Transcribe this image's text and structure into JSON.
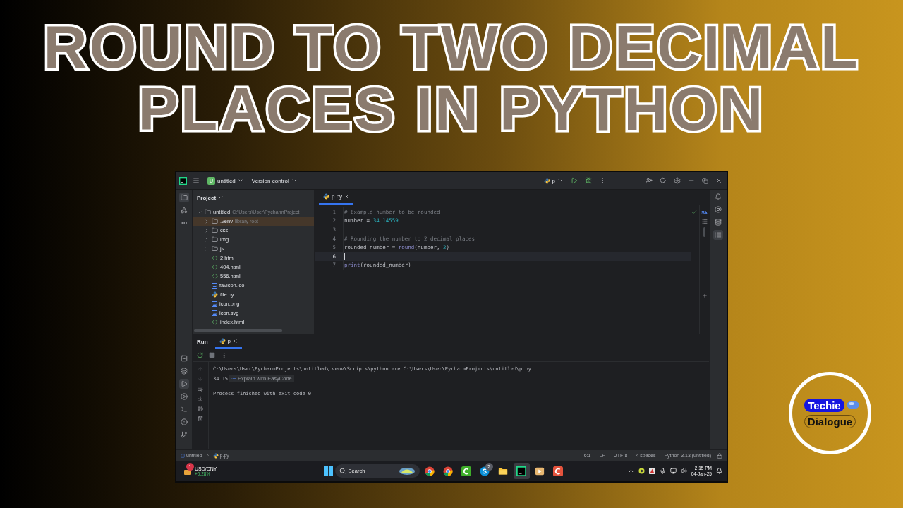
{
  "headline": [
    "ROUND TO TWO DECIMAL",
    "PLACES IN PYTHON"
  ],
  "ide": {
    "toolbar": {
      "project_badge": "U",
      "project": "untitled",
      "vcs": "Version control",
      "run_config": "p"
    },
    "project_panel": {
      "title": "Project",
      "tree": [
        {
          "name": "untitled",
          "path": "C:\\Users\\User\\PycharmProject",
          "kind": "folder",
          "expanded": true,
          "selected": false,
          "children": [
            {
              "name": ".venv",
              "note": "library root",
              "kind": "folder",
              "expanded": false,
              "selected": true
            },
            {
              "name": "css",
              "kind": "folder",
              "expanded": false,
              "selected": false
            },
            {
              "name": "img",
              "kind": "folder",
              "expanded": false,
              "selected": false
            },
            {
              "name": "js",
              "kind": "folder",
              "expanded": false,
              "selected": false
            },
            {
              "name": "2.html",
              "kind": "html",
              "selected": false
            },
            {
              "name": "404.html",
              "kind": "html",
              "selected": false
            },
            {
              "name": "556.html",
              "kind": "html",
              "selected": false
            },
            {
              "name": "favicon.ico",
              "kind": "image",
              "selected": false
            },
            {
              "name": "file.py",
              "kind": "python",
              "selected": false
            },
            {
              "name": "icon.png",
              "kind": "image",
              "selected": false
            },
            {
              "name": "icon.svg",
              "kind": "image",
              "selected": false
            },
            {
              "name": "index.html",
              "kind": "html",
              "selected": false
            }
          ]
        }
      ]
    },
    "editor": {
      "tabs": [
        {
          "label": "p.py",
          "selected": true
        }
      ],
      "side_label": "Sk",
      "lines": [
        {
          "number": "1",
          "current": false,
          "tokens": [
            {
              "text": "# Example number to be rounded",
              "kind": "comment"
            }
          ]
        },
        {
          "number": "2",
          "current": false,
          "tokens": [
            {
              "text": "number = ",
              "kind": "plain"
            },
            {
              "text": "34.14559",
              "kind": "number"
            }
          ]
        },
        {
          "number": "3",
          "current": false
        },
        {
          "number": "4",
          "current": false,
          "tokens": [
            {
              "text": "# Rounding the number to 2 decimal places",
              "kind": "comment"
            }
          ]
        },
        {
          "number": "5",
          "current": false,
          "tokens": [
            {
              "text": "rounded_number = ",
              "kind": "plain"
            },
            {
              "text": "round",
              "kind": "builtin"
            },
            {
              "text": "(number, ",
              "kind": "plain"
            },
            {
              "text": "2",
              "kind": "number"
            },
            {
              "text": ")",
              "kind": "plain"
            }
          ]
        },
        {
          "number": "6",
          "current": true
        },
        {
          "number": "7",
          "current": false,
          "tokens": [
            {
              "text": "print",
              "kind": "builtin"
            },
            {
              "text": "(rounded_number)",
              "kind": "plain"
            }
          ]
        }
      ]
    },
    "run_panel": {
      "title": "Run",
      "tabs": [
        {
          "label": "p",
          "selected": true
        }
      ],
      "command": "C:\\Users\\User\\PycharmProjects\\untitled\\.venv\\Scripts\\python.exe C:\\Users\\User\\PycharmProjects\\untitled\\p.py",
      "result": "34.15",
      "result_action": "Explain with EasyCode",
      "exit_message": "Process finished with exit code 0"
    },
    "status_bar": {
      "breadcrumb": [
        "untitled",
        "p.py"
      ],
      "items": [
        "6:1",
        "LF",
        "UTF-8",
        "4 spaces",
        "Python 3.13 (untitled)"
      ]
    }
  },
  "taskbar": {
    "widget": {
      "badge": "1",
      "title": "USD/CNY",
      "change": "+0.28%"
    },
    "search": {
      "label": "Search"
    },
    "apps": [
      {
        "kind": "chrome",
        "active": false
      },
      {
        "kind": "chrome",
        "active": false
      },
      {
        "kind": "green-app",
        "active": false
      },
      {
        "kind": "skype",
        "badge": "2",
        "active": false
      },
      {
        "kind": "folder",
        "active": false
      },
      {
        "kind": "pycharm",
        "active": true
      },
      {
        "kind": "player",
        "active": false
      },
      {
        "kind": "red-app",
        "active": false
      }
    ],
    "clock": {
      "time": "2:15 PM",
      "date": "04-Jan-25"
    }
  },
  "logo": {
    "top": "Techie",
    "bottom": "Dialogue"
  }
}
